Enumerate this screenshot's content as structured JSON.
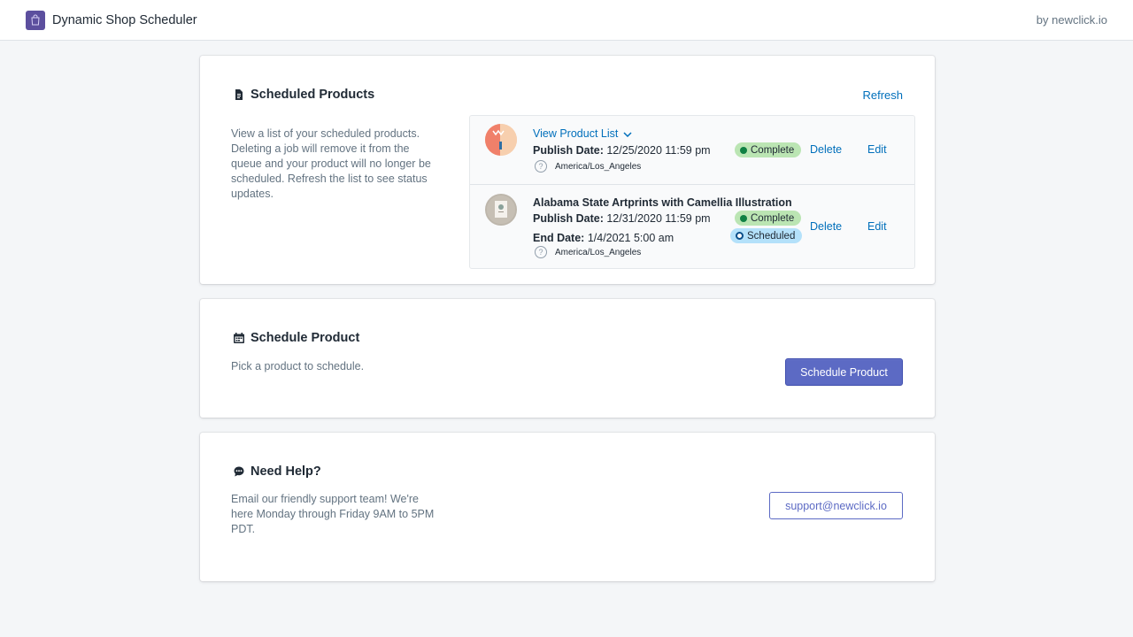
{
  "header": {
    "app_title": "Dynamic Shop Scheduler",
    "byline": "by newclick.io",
    "logo_icon": "shopping-bag-icon",
    "logo_color": "#5c4f9e"
  },
  "scheduled_products": {
    "heading": "Scheduled Products",
    "heading_icon": "document-icon",
    "description": "View a list of your scheduled products. Deleting a job will remove it from the queue and your product will no longer be scheduled. Refresh the list to see status updates.",
    "refresh_label": "Refresh",
    "items": [
      {
        "title_link": "View Product List",
        "publish_label": "Publish Date:",
        "publish_value": "12/25/2020 11:59 pm",
        "timezone": "America/Los_Angeles",
        "status": "Complete",
        "delete_label": "Delete",
        "edit_label": "Edit"
      },
      {
        "title": "Alabama State Artprints with Camellia Illustration",
        "publish_label": "Publish Date:",
        "publish_value": "12/31/2020 11:59 pm",
        "end_label": "End Date:",
        "end_value": "1/4/2021 5:00 am",
        "timezone": "America/Los_Angeles",
        "status_publish": "Complete",
        "status_end": "Scheduled",
        "delete_label": "Delete",
        "edit_label": "Edit"
      }
    ]
  },
  "schedule_product": {
    "heading": "Schedule Product",
    "heading_icon": "calendar-icon",
    "description": "Pick a product to schedule.",
    "button_label": "Schedule Product"
  },
  "help": {
    "heading": "Need Help?",
    "heading_icon": "chat-bubble-icon",
    "description": "Email our friendly support team! We're here Monday through Friday 9AM to 5PM PDT.",
    "button_label": "support@newclick.io"
  },
  "colors": {
    "primary": "#5c6ac4",
    "link": "#006fbb",
    "complete_badge": "#bbe5b3",
    "scheduled_badge": "#b4e1fa"
  }
}
